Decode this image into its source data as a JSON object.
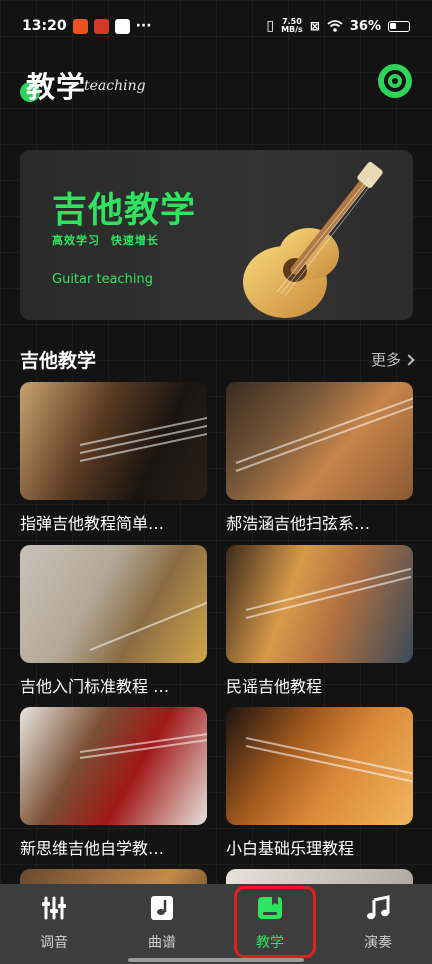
{
  "status_bar": {
    "time": "13:20",
    "net_speed_top": "7.50",
    "net_speed_bottom": "MB/s",
    "battery": "36%"
  },
  "header": {
    "title": "教学",
    "subtitle": "teaching"
  },
  "banner": {
    "title": "吉他教学",
    "tags": "高效学习 快速增长",
    "subtitle": "Guitar teaching"
  },
  "section": {
    "title": "吉他教学",
    "more_label": "更多"
  },
  "courses": [
    {
      "title": "指弹吉他教程简单…"
    },
    {
      "title": "郝浩涵吉他扫弦系…"
    },
    {
      "title": "吉他入门标准教程 …"
    },
    {
      "title": "民谣吉他教程"
    },
    {
      "title": "新思维吉他自学教…"
    },
    {
      "title": "小白基础乐理教程"
    }
  ],
  "bottom_nav": {
    "items": [
      {
        "label": "调音",
        "icon": "tuner-sliders-icon"
      },
      {
        "label": "曲谱",
        "icon": "sheet-music-icon"
      },
      {
        "label": "教学",
        "icon": "teaching-book-icon"
      },
      {
        "label": "演奏",
        "icon": "music-note-icon"
      }
    ],
    "active_index": 2
  },
  "colors": {
    "accent": "#2ee35e",
    "background": "#131313",
    "nav_background": "#3d3d3d",
    "highlight": "#e02020"
  }
}
